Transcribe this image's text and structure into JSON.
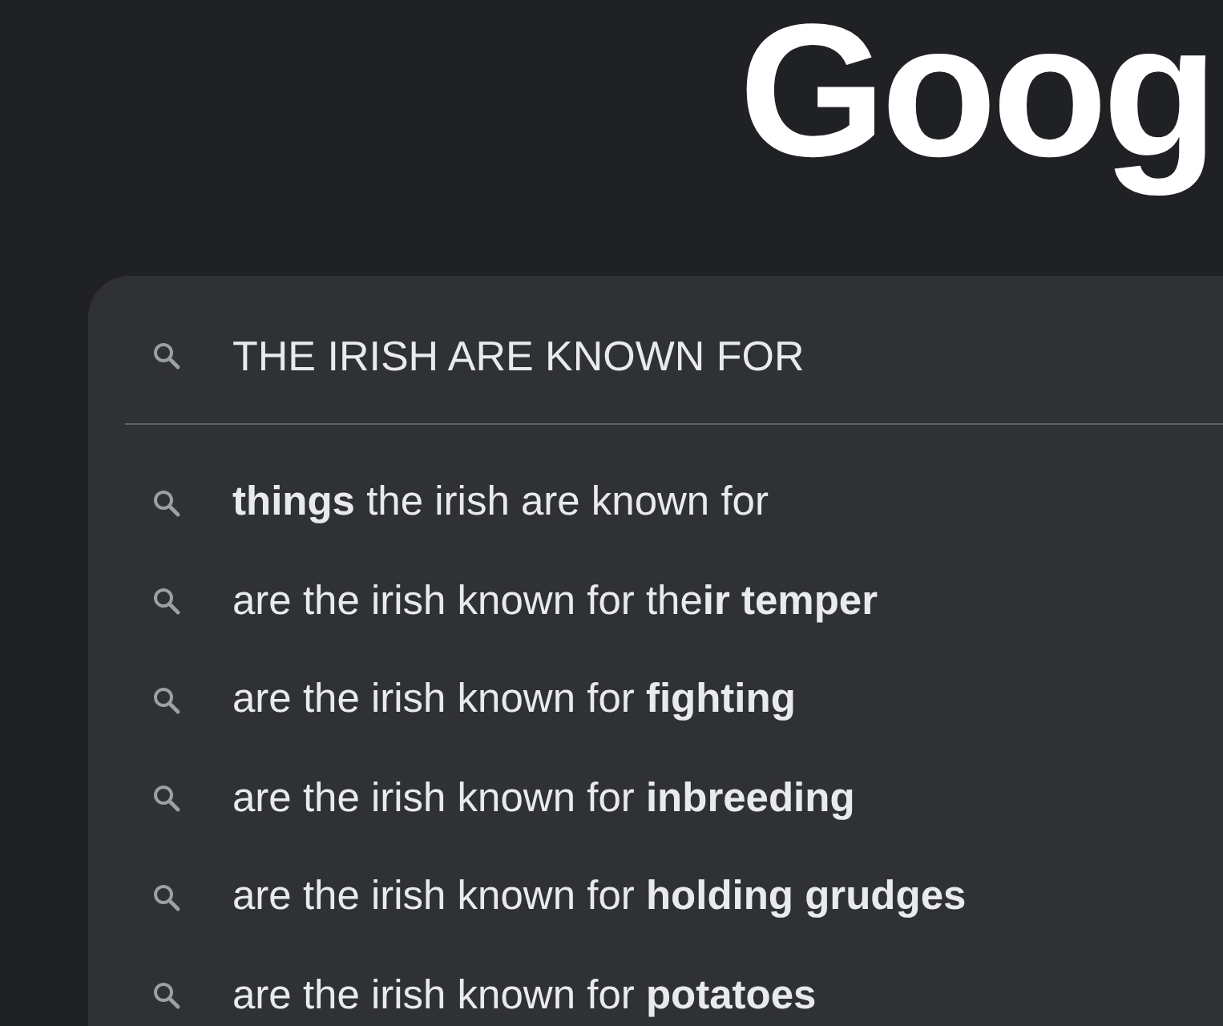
{
  "logo": {
    "text": "Goog"
  },
  "search": {
    "value": "THE IRISH ARE KNOWN FOR"
  },
  "suggestions": [
    {
      "text": "**things** the irish are known for"
    },
    {
      "text": "are the irish known for the**ir temper**"
    },
    {
      "text": "are the irish known for **fighting**"
    },
    {
      "text": "are the irish known for **inbreeding**"
    },
    {
      "text": "are the irish known for **holding grudges**"
    },
    {
      "text": "are the irish known for **potatoes**"
    }
  ]
}
